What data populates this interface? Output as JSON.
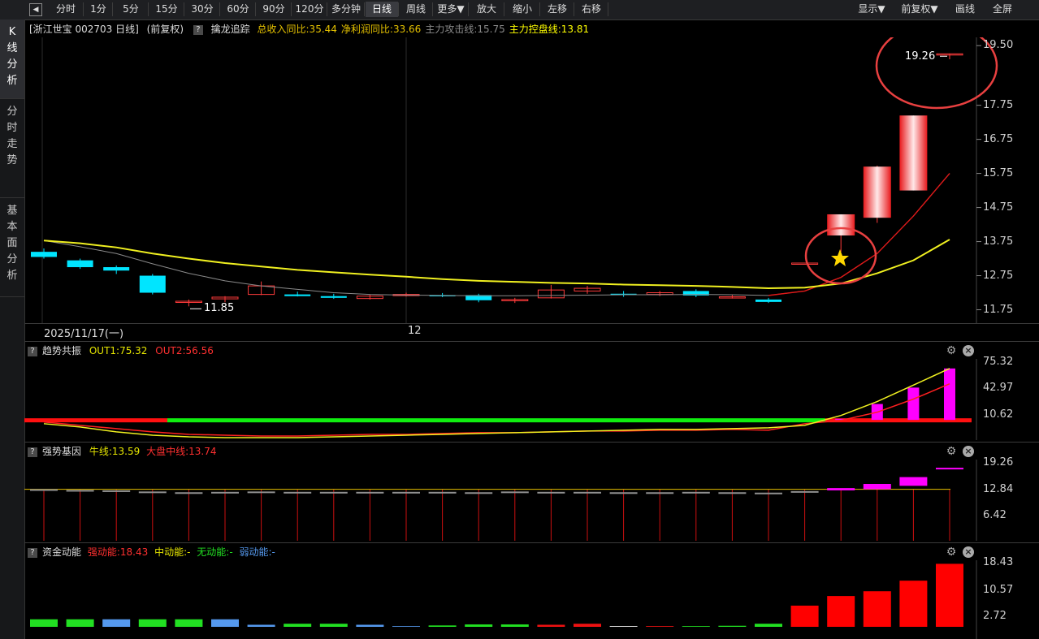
{
  "toolbar": {
    "back_glyph": "◀",
    "items": [
      "分时",
      "1分",
      "5分",
      "15分",
      "30分",
      "60分",
      "90分",
      "120分",
      "多分钟",
      "日线",
      "周线",
      "更多▼",
      "放大",
      "缩小",
      "左移",
      "右移"
    ],
    "active": "日线",
    "right_items": [
      "显示▼",
      "前复权▼",
      "画线",
      "全屏"
    ]
  },
  "left_tabs": [
    {
      "label": "K线分析",
      "lines": [
        "K",
        "线",
        "分",
        "析"
      ]
    },
    {
      "label": "分时走势",
      "lines": [
        "分",
        "时",
        "走",
        "势"
      ]
    },
    {
      "label": "基本面分析",
      "lines": [
        "基",
        "本",
        "面",
        "分",
        "析"
      ]
    }
  ],
  "main_header": {
    "stock": "[浙江世宝 002703 日线]",
    "adjust": "(前复权)",
    "indicator_name": "擒龙追踪",
    "metrics": [
      {
        "text": "总收入同比:35.44",
        "color": "#e6c200"
      },
      {
        "text": "净利润同比:33.66",
        "color": "#e6c200"
      },
      {
        "text": "主力攻击线:15.75",
        "color": "#8a8a8a"
      },
      {
        "text": "主力控盘线:13.81",
        "color": "#ffff00"
      }
    ]
  },
  "price_axis": [
    "19.50",
    "17.75",
    "16.75",
    "15.75",
    "14.75",
    "13.75",
    "12.75",
    "11.75"
  ],
  "date_label": "2025/11/17(一)",
  "month_label": "12",
  "low_label": "11.85",
  "high_label": "19.26",
  "chart_data": {
    "type": "candlestick",
    "ylim": [
      11.5,
      19.6
    ],
    "candles": [
      {
        "o": 13.45,
        "h": 13.55,
        "l": 13.25,
        "c": 13.3,
        "up": false
      },
      {
        "o": 13.2,
        "h": 13.25,
        "l": 12.95,
        "c": 13.0,
        "up": false
      },
      {
        "o": 13.0,
        "h": 13.05,
        "l": 12.8,
        "c": 12.9,
        "up": false
      },
      {
        "o": 12.75,
        "h": 12.8,
        "l": 12.2,
        "c": 12.25,
        "up": false
      },
      {
        "o": 11.97,
        "h": 12.05,
        "l": 11.85,
        "c": 12.0,
        "up": true
      },
      {
        "o": 12.07,
        "h": 12.15,
        "l": 11.97,
        "c": 12.12,
        "up": true
      },
      {
        "o": 12.2,
        "h": 12.58,
        "l": 12.18,
        "c": 12.45,
        "up": true
      },
      {
        "o": 12.2,
        "h": 12.28,
        "l": 12.14,
        "c": 12.15,
        "up": false
      },
      {
        "o": 12.15,
        "h": 12.22,
        "l": 12.07,
        "c": 12.1,
        "up": false
      },
      {
        "o": 12.08,
        "h": 12.2,
        "l": 12.05,
        "c": 12.15,
        "up": true
      },
      {
        "o": 12.18,
        "h": 12.25,
        "l": 12.14,
        "c": 12.2,
        "up": true
      },
      {
        "o": 12.18,
        "h": 12.24,
        "l": 12.12,
        "c": 12.15,
        "up": false
      },
      {
        "o": 12.18,
        "h": 12.22,
        "l": 11.97,
        "c": 12.03,
        "up": false
      },
      {
        "o": 12.05,
        "h": 12.1,
        "l": 11.95,
        "c": 12.05,
        "up": true
      },
      {
        "o": 12.1,
        "h": 12.48,
        "l": 12.08,
        "c": 12.33,
        "up": true
      },
      {
        "o": 12.3,
        "h": 12.45,
        "l": 12.22,
        "c": 12.38,
        "up": true
      },
      {
        "o": 12.22,
        "h": 12.3,
        "l": 12.13,
        "c": 12.18,
        "up": false
      },
      {
        "o": 12.2,
        "h": 12.3,
        "l": 12.15,
        "c": 12.25,
        "up": true
      },
      {
        "o": 12.3,
        "h": 12.35,
        "l": 12.12,
        "c": 12.17,
        "up": false
      },
      {
        "o": 12.13,
        "h": 12.18,
        "l": 12.08,
        "c": 12.1,
        "up": true
      },
      {
        "o": 12.05,
        "h": 12.1,
        "l": 11.95,
        "c": 11.98,
        "up": false
      },
      {
        "o": 13.12,
        "h": 13.12,
        "l": 13.12,
        "c": 13.12,
        "up": true
      },
      {
        "o": 13.93,
        "h": 14.55,
        "l": 13.45,
        "c": 14.55,
        "up": true
      },
      {
        "o": 14.45,
        "h": 15.98,
        "l": 14.3,
        "c": 15.95,
        "up": true
      },
      {
        "o": 15.25,
        "h": 17.45,
        "l": 15.25,
        "c": 17.45,
        "up": true
      },
      {
        "o": 19.26,
        "h": 19.26,
        "l": 19.1,
        "c": 19.26,
        "up": true
      }
    ],
    "ma_yellow": [
      13.78,
      13.7,
      13.58,
      13.4,
      13.25,
      13.12,
      13.02,
      12.92,
      12.85,
      12.78,
      12.72,
      12.65,
      12.6,
      12.57,
      12.54,
      12.52,
      12.49,
      12.47,
      12.45,
      12.42,
      12.38,
      12.4,
      12.52,
      12.82,
      13.2,
      13.81
    ],
    "ma_gray": [
      13.78,
      13.6,
      13.4,
      13.1,
      12.82,
      12.6,
      12.45,
      12.35,
      12.25,
      12.2,
      12.18,
      12.17,
      12.16,
      12.16,
      12.17,
      12.18,
      12.19,
      12.19,
      12.2,
      12.19,
      12.17,
      12.3,
      12.7,
      13.4,
      14.5,
      15.75
    ],
    "panel1": {
      "title": "趋势共振",
      "out1_label": "OUT1:75.32",
      "out2_label": "OUT2:56.56",
      "axis": [
        "75.32",
        "42.97",
        "10.62"
      ],
      "ylim": [
        -10,
        85
      ],
      "yellow": [
        8,
        4,
        -2,
        -6,
        -8,
        -9,
        -9,
        -9,
        -8,
        -7,
        -6,
        -5,
        -4,
        -3,
        -2,
        -1,
        0,
        1,
        1,
        2,
        3,
        6,
        18,
        35,
        55,
        75.32
      ],
      "red": [
        10,
        6,
        2,
        -2,
        -5,
        -6,
        -7,
        -7,
        -6,
        -5,
        -5,
        -4,
        -3,
        -3,
        -2,
        -1,
        -1,
        0,
        0,
        1,
        0,
        8,
        12,
        22,
        38,
        56.56
      ],
      "bars": [
        0,
        0,
        0,
        0,
        0,
        0,
        0,
        0,
        0,
        0,
        0,
        0,
        0,
        0,
        0,
        0,
        0,
        0,
        0,
        0,
        0,
        0,
        14,
        32,
        52,
        75.32
      ],
      "green_from": 4,
      "green_to": 21
    },
    "panel2": {
      "title": "强势基因",
      "bull_label": "牛线:13.59",
      "market_label": "大盘中线:13.74",
      "axis": [
        "19.26",
        "12.84",
        "6.42"
      ],
      "ylim": [
        0,
        21
      ],
      "bars_top": [
        13.6,
        13.4,
        13.3,
        13.0,
        12.8,
        12.9,
        13.0,
        12.9,
        12.9,
        12.9,
        12.9,
        12.9,
        12.8,
        13.0,
        12.9,
        12.9,
        12.8,
        12.8,
        12.9,
        12.8,
        12.7,
        13.1,
        13.9,
        15.0,
        16.8,
        19.26
      ],
      "bars_bottom": [
        13.2,
        13.1,
        12.9,
        12.6,
        12.5,
        12.6,
        12.6,
        12.7,
        12.6,
        12.6,
        12.7,
        12.6,
        12.6,
        12.7,
        12.7,
        12.7,
        12.6,
        12.6,
        12.6,
        12.6,
        12.5,
        13.0,
        13.3,
        13.6,
        14.5,
        19.0
      ],
      "bars_kind": [
        "g",
        "g",
        "g",
        "g",
        "g",
        "g",
        "g",
        "g",
        "g",
        "g",
        "g",
        "g",
        "g",
        "g",
        "g",
        "g",
        "g",
        "g",
        "g",
        "g",
        "g",
        "g",
        "m",
        "m",
        "m",
        "m"
      ],
      "line": 13.59
    },
    "panel3": {
      "title": "资金动能",
      "strong": "强动能:18.43",
      "mid": "中动能:-",
      "none": "无动能:-",
      "weak": "弱动能:-",
      "axis": [
        "18.43",
        "10.57",
        "2.72"
      ],
      "ylim": [
        0,
        19
      ],
      "bars": [
        {
          "v": 2.2,
          "c": "#22e022"
        },
        {
          "v": 2.2,
          "c": "#22e022"
        },
        {
          "v": 2.2,
          "c": "#5599ee"
        },
        {
          "v": 2.2,
          "c": "#22e022"
        },
        {
          "v": 2.2,
          "c": "#22e022"
        },
        {
          "v": 2.2,
          "c": "#5599ee"
        },
        {
          "v": 0.6,
          "c": "#5599ee"
        },
        {
          "v": 0.9,
          "c": "#22e022"
        },
        {
          "v": 0.9,
          "c": "#22e022"
        },
        {
          "v": 0.6,
          "c": "#5599ee"
        },
        {
          "v": 0.2,
          "c": "#5599ee"
        },
        {
          "v": 0.4,
          "c": "#22e022"
        },
        {
          "v": 0.7,
          "c": "#22e022"
        },
        {
          "v": 0.7,
          "c": "#22e022"
        },
        {
          "v": 0.6,
          "c": "#ee1111"
        },
        {
          "v": 0.9,
          "c": "#ee1111"
        },
        {
          "v": 0.2,
          "c": "#ffffff"
        },
        {
          "v": 0.2,
          "c": "#ee1111"
        },
        {
          "v": 0.2,
          "c": "#22e022"
        },
        {
          "v": 0.3,
          "c": "#22e022"
        },
        {
          "v": 0.9,
          "c": "#22e022"
        },
        {
          "v": 6.2,
          "c": "#ff0000"
        },
        {
          "v": 9.0,
          "c": "#ff0000"
        },
        {
          "v": 10.4,
          "c": "#ff0000"
        },
        {
          "v": 13.5,
          "c": "#ff0000"
        },
        {
          "v": 18.43,
          "c": "#ff0000"
        }
      ]
    }
  }
}
